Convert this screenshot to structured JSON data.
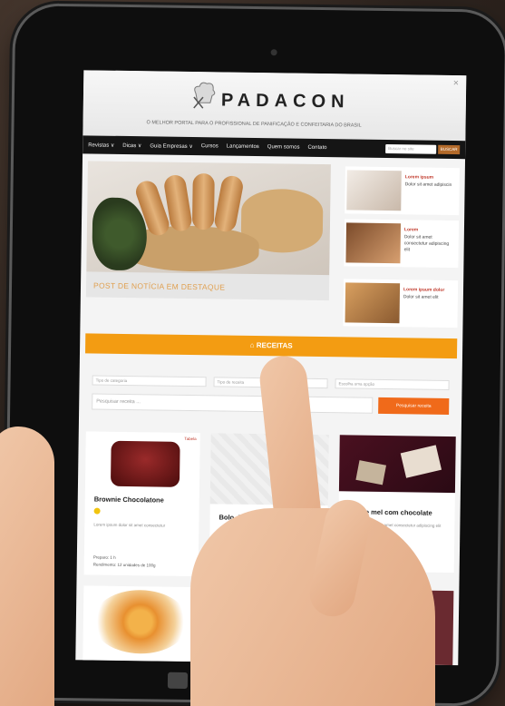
{
  "site": {
    "logo": "PADACON",
    "tagline": "O MELHOR PORTAL PARA O PROFISSIONAL DE PANIFICAÇÃO E CONFEITARIA DO BRASIL"
  },
  "nav": {
    "items": [
      "Revistas ∨",
      "Dicas ∨",
      "Guia Empresas ∨",
      "Cursos",
      "Lançamentos",
      "Quem somos",
      "Contato"
    ],
    "search_placeholder": "Buscar no site",
    "search_button": "BUSCAR"
  },
  "featured": {
    "caption": "POST DE NOTÍCIA EM DESTAQUE"
  },
  "side_posts": [
    {
      "tag": "Lorem ipsum",
      "text": "Dolor sit amet adipiscin"
    },
    {
      "tag": "Lorem",
      "text": "Dolor sit amet consectetur adipiscing elit"
    },
    {
      "tag": "Lorem ipsum dolor",
      "text": "Dolor sit amet elit"
    }
  ],
  "receitas": {
    "label": "RECEITAS",
    "icon": "home-icon"
  },
  "filters": {
    "select1": "Tipo de categoria",
    "select2": "Tipo de receita",
    "select3": "Escolha uma opção",
    "search_placeholder": "Pesquisar receita ...",
    "search_button": "Pesquisar receita"
  },
  "cards": [
    {
      "title": "Brownie Chocolatone",
      "text": "Lorem ipsum dolor sit amet consectetur",
      "tag": "Tabela"
    },
    {
      "title": "Bolo de coco",
      "text": ""
    },
    {
      "title": "Bolo de mel com chocolate",
      "text": "Lorem ipsum dolor sit amet consectetur adipiscing elit"
    }
  ],
  "card_meta": {
    "time": "Preparo: 1 h",
    "yield": "Rendimento: 12 unidades de 100g"
  },
  "colors": {
    "accent_orange": "#f39c12",
    "nav_dark": "#151515",
    "button_orange": "#f06a1a"
  }
}
